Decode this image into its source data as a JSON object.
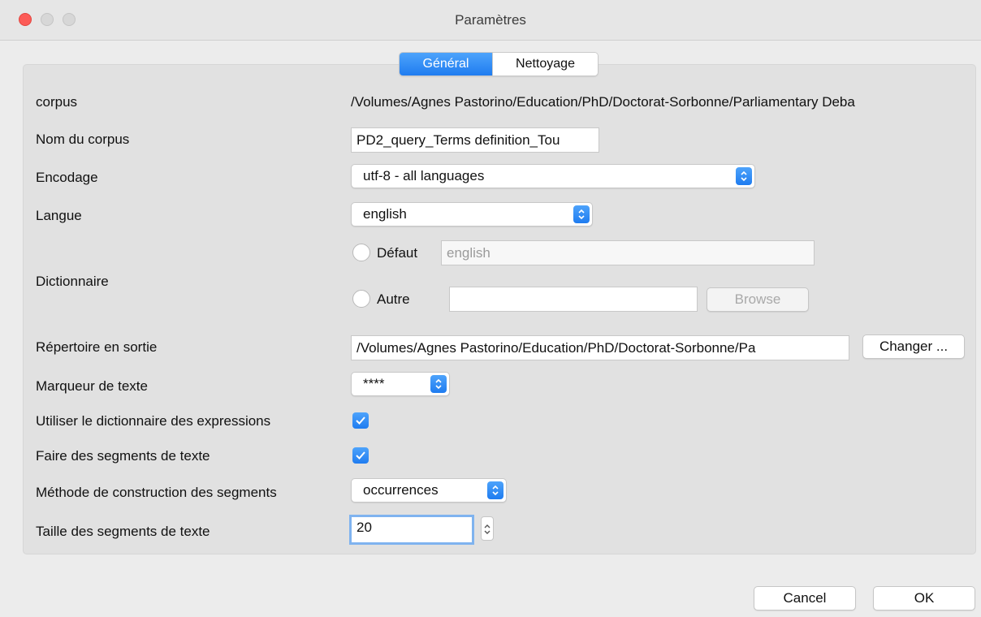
{
  "window": {
    "title": "Paramètres"
  },
  "tabs": [
    {
      "label": "Général",
      "active": true
    },
    {
      "label": "Nettoyage",
      "active": false
    }
  ],
  "form": {
    "corpus": {
      "label": "corpus",
      "value": "/Volumes/Agnes Pastorino/Education/PhD/Doctorat-Sorbonne/Parliamentary Deba"
    },
    "corpus_name": {
      "label": "Nom du corpus",
      "value": "PD2_query_Terms definition_Tou"
    },
    "encoding": {
      "label": "Encodage",
      "value": "utf-8 - all languages"
    },
    "language": {
      "label": "Langue",
      "value": "english"
    },
    "dictionary": {
      "label": "Dictionnaire",
      "default_label": "Défaut",
      "default_placeholder": "english",
      "other_label": "Autre",
      "other_value": "",
      "browse_label": "Browse"
    },
    "output_dir": {
      "label": "Répertoire en sortie",
      "value": "/Volumes/Agnes Pastorino/Education/PhD/Doctorat-Sorbonne/Pa",
      "button_label": "Changer ..."
    },
    "text_marker": {
      "label": "Marqueur de texte",
      "value": "****"
    },
    "use_expressions": {
      "label": "Utiliser le dictionnaire des expressions",
      "checked": true
    },
    "make_segments": {
      "label": "Faire des segments de texte",
      "checked": true
    },
    "segment_method": {
      "label": "Méthode de construction des segments",
      "value": "occurrences"
    },
    "segment_size": {
      "label": "Taille des segments de texte",
      "value": "20"
    }
  },
  "footer": {
    "cancel_label": "Cancel",
    "ok_label": "OK"
  },
  "colors": {
    "accent": "#1f7cf0",
    "close": "#fc5b57",
    "panel": "#e1e1e1",
    "background": "#ececec"
  }
}
